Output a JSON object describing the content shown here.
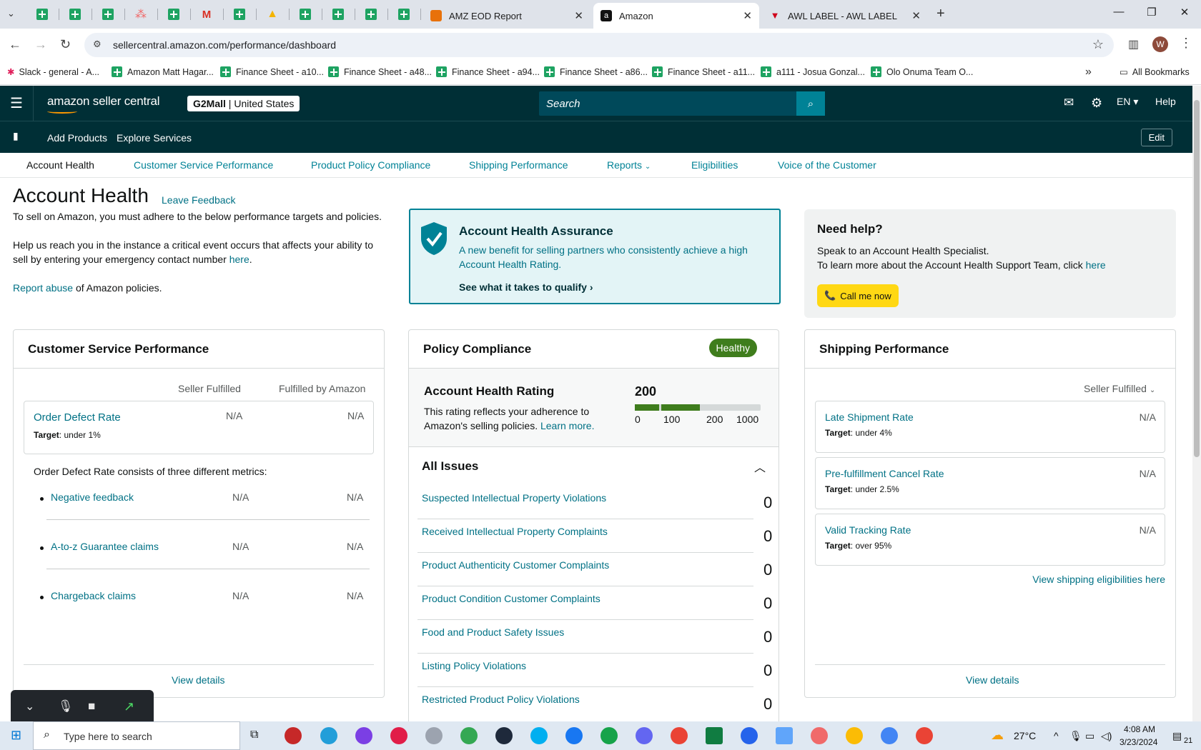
{
  "browser": {
    "tabs": [
      {
        "title": "AMZ EOD Report",
        "icon": "edit-icon"
      },
      {
        "title": "Amazon",
        "icon": "amazon-icon"
      },
      {
        "title": "AWL LABEL - AWL LABEL",
        "icon": "awl-icon"
      }
    ],
    "url": "sellercentral.amazon.com/performance/dashboard",
    "profile_initial": "W",
    "bookmarks": [
      "Slack - general - A...",
      "Amazon Matt Hagar...",
      "Finance Sheet - a10...",
      "Finance Sheet - a48...",
      "Finance Sheet - a94...",
      "Finance Sheet - a86...",
      "Finance Sheet - a11...",
      "a111 - Josua Gonzal...",
      "Olo Onuma Team O..."
    ],
    "all_bookmarks": "All Bookmarks"
  },
  "header": {
    "logo": "amazon seller central",
    "store": "G2Mall",
    "marketplace": "United States",
    "search_placeholder": "Search",
    "language": "EN",
    "help": "Help"
  },
  "subbar": {
    "add_products": "Add Products",
    "explore_services": "Explore Services",
    "edit": "Edit"
  },
  "nav": [
    "Account Health",
    "Customer Service Performance",
    "Product Policy Compliance",
    "Shipping Performance",
    "Reports",
    "Eligibilities",
    "Voice of the Customer"
  ],
  "page": {
    "title": "Account Health",
    "leave_feedback": "Leave Feedback",
    "intro1": "To sell on Amazon, you must adhere to the below performance targets and policies.",
    "intro2": "Help us reach you in the instance a critical event occurs that affects your ability to sell by entering your emergency contact number",
    "intro2_link": "here",
    "report_abuse": "Report abuse",
    "report_abuse_rest": "of Amazon policies."
  },
  "assurance": {
    "title": "Account Health Assurance",
    "desc": "A new benefit for selling partners who consistently achieve a high Account Health Rating.",
    "cta": "See what it takes to qualify"
  },
  "help_box": {
    "title": "Need help?",
    "line1": "Speak to an Account Health Specialist.",
    "line2": "To learn more about the Account Health Support Team, click",
    "line2_link": "here",
    "call": "Call me now"
  },
  "csp": {
    "title": "Customer Service Performance",
    "col1": "Seller Fulfilled",
    "col2": "Fulfilled by Amazon",
    "odr": {
      "name": "Order Defect Rate",
      "target_label": "Target",
      "target": ": under 1%",
      "v1": "N/A",
      "v2": "N/A"
    },
    "consists": "Order Defect Rate consists of three different metrics:",
    "items": [
      {
        "name": "Negative feedback",
        "v1": "N/A",
        "v2": "N/A"
      },
      {
        "name": "A-to-z Guarantee claims",
        "v1": "N/A",
        "v2": "N/A"
      },
      {
        "name": "Chargeback claims",
        "v1": "N/A",
        "v2": "N/A"
      }
    ],
    "view": "View details"
  },
  "policy": {
    "title": "Policy Compliance",
    "badge": "Healthy",
    "ahr_title": "Account Health Rating",
    "ahr_desc": "This rating reflects your adherence to Amazon's selling policies.",
    "learn_more": "Learn more.",
    "rating": "200",
    "scale": [
      "0",
      "100",
      "200",
      "1000"
    ],
    "issues_title": "All Issues",
    "issues": [
      {
        "name": "Suspected Intellectual Property Violations",
        "count": "0"
      },
      {
        "name": "Received Intellectual Property Complaints",
        "count": "0"
      },
      {
        "name": "Product Authenticity Customer Complaints",
        "count": "0"
      },
      {
        "name": "Product Condition Customer Complaints",
        "count": "0"
      },
      {
        "name": "Food and Product Safety Issues",
        "count": "0"
      },
      {
        "name": "Listing Policy Violations",
        "count": "0"
      },
      {
        "name": "Restricted Product Policy Violations",
        "count": "0"
      }
    ]
  },
  "shipping": {
    "title": "Shipping Performance",
    "filter": "Seller Fulfilled",
    "metrics": [
      {
        "name": "Late Shipment Rate",
        "target_label": "Target",
        "target": ": under 4%",
        "value": "N/A"
      },
      {
        "name": "Pre-fulfillment Cancel Rate",
        "target_label": "Target",
        "target": ": under 2.5%",
        "value": "N/A"
      },
      {
        "name": "Valid Tracking Rate",
        "target_label": "Target",
        "target": ": over 95%",
        "value": "N/A"
      }
    ],
    "eligibilities": "View shipping eligibilities here",
    "view": "View details"
  },
  "taskbar": {
    "search_placeholder": "Type here to search",
    "temperature": "27°C",
    "time": "4:08 AM",
    "date": "3/23/2024",
    "notifications": "21"
  },
  "colors": {
    "amazon_dark": "#002f36",
    "teal_link": "#007185",
    "healthy": "#3f7d1d",
    "call_btn": "#ffd814"
  }
}
